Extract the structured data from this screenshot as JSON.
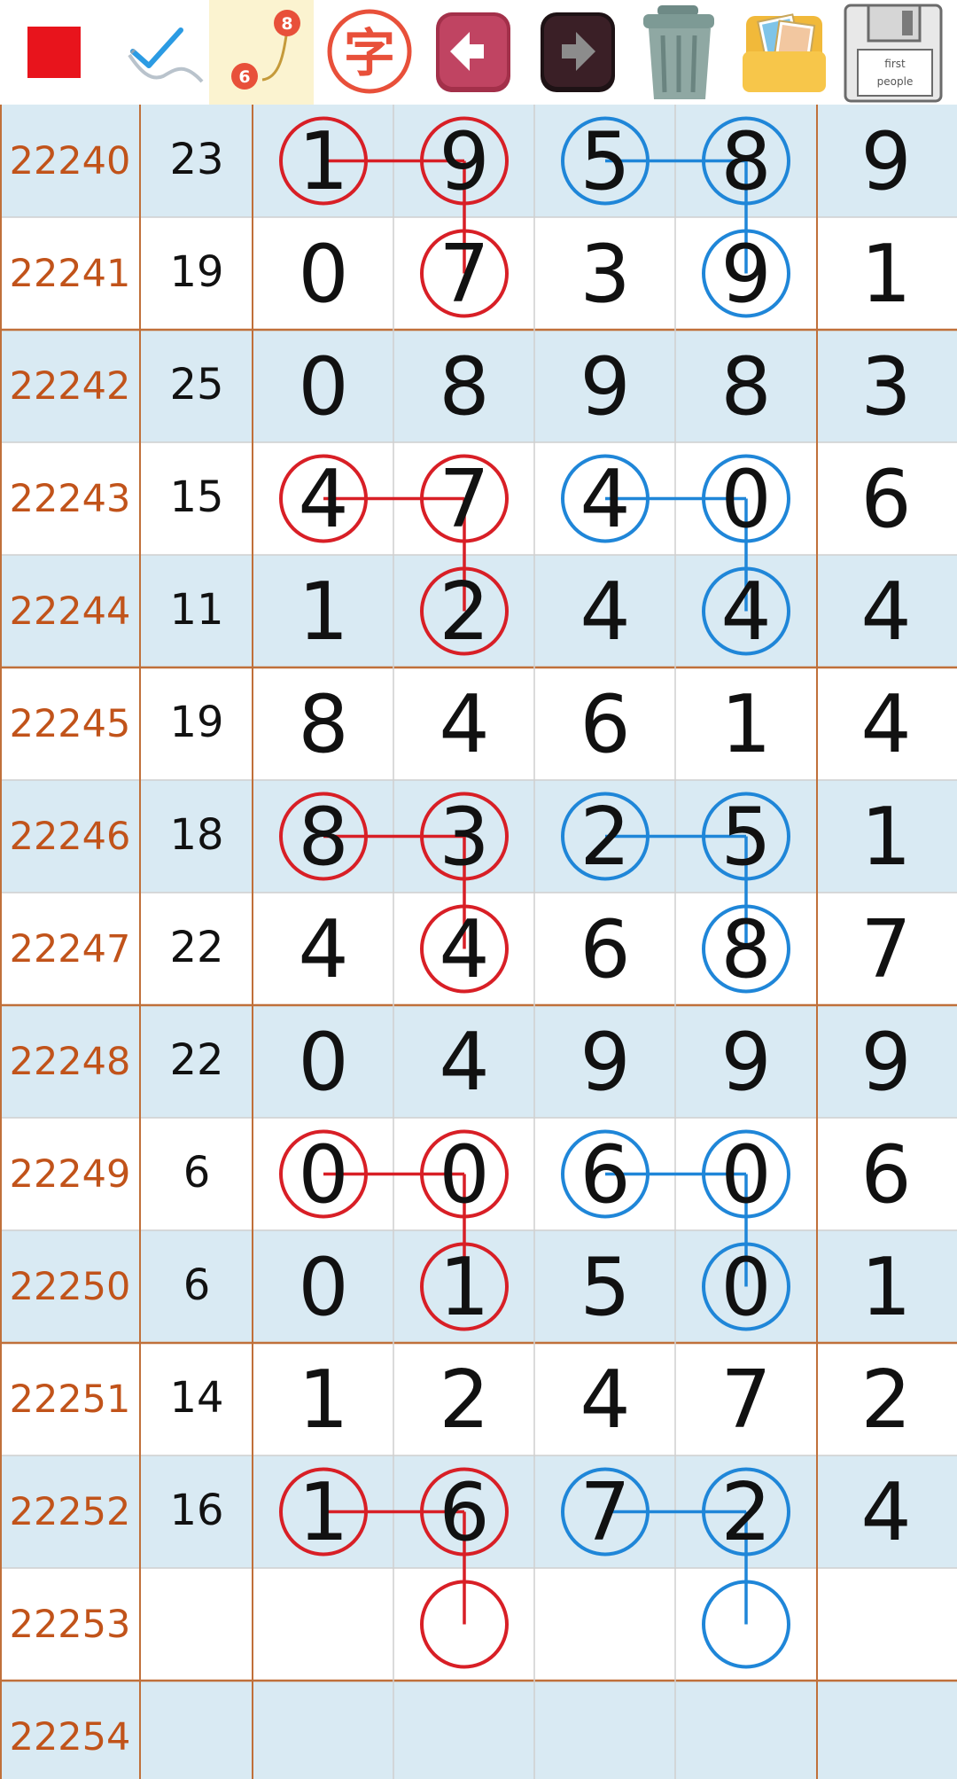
{
  "toolbar": {
    "buttons": [
      {
        "name": "red-square-color-button",
        "icon": "red-square-icon",
        "color": "#e8141c"
      },
      {
        "name": "checkmark-pen-button",
        "icon": "checkmark-pen-icon"
      },
      {
        "name": "connect-line-tool-button",
        "icon": "connect-line-icon",
        "label_top": "8",
        "label_bottom": "6",
        "active": true
      },
      {
        "name": "text-tool-button",
        "icon": "zi-character-icon",
        "label": "字"
      },
      {
        "name": "undo-button",
        "icon": "arrow-left-icon"
      },
      {
        "name": "redo-button",
        "icon": "arrow-right-icon"
      },
      {
        "name": "trash-button",
        "icon": "trash-can-icon"
      },
      {
        "name": "photo-folder-button",
        "icon": "photo-folder-icon"
      },
      {
        "name": "save-button",
        "icon": "floppy-disk-icon",
        "label_lines": [
          "first",
          "people"
        ]
      }
    ]
  },
  "colors": {
    "issue_text": "#c1531a",
    "row_shade": "#d9eaf3",
    "row_plain": "#ffffff",
    "red_mark": "#d81f26",
    "blue_mark": "#1f86d8",
    "group_line": "#c0703a",
    "grid_line": "#cfcfcf"
  },
  "rows": [
    {
      "issue": "22240",
      "sum": "23",
      "digits": [
        "1",
        "9",
        "5",
        "8",
        "9"
      ]
    },
    {
      "issue": "22241",
      "sum": "19",
      "digits": [
        "0",
        "7",
        "3",
        "9",
        "1"
      ]
    },
    {
      "issue": "22242",
      "sum": "25",
      "digits": [
        "0",
        "8",
        "9",
        "8",
        "3"
      ]
    },
    {
      "issue": "22243",
      "sum": "15",
      "digits": [
        "4",
        "7",
        "4",
        "0",
        "6"
      ]
    },
    {
      "issue": "22244",
      "sum": "11",
      "digits": [
        "1",
        "2",
        "4",
        "4",
        "4"
      ]
    },
    {
      "issue": "22245",
      "sum": "19",
      "digits": [
        "8",
        "4",
        "6",
        "1",
        "4"
      ]
    },
    {
      "issue": "22246",
      "sum": "18",
      "digits": [
        "8",
        "3",
        "2",
        "5",
        "1"
      ]
    },
    {
      "issue": "22247",
      "sum": "22",
      "digits": [
        "4",
        "4",
        "6",
        "8",
        "7"
      ]
    },
    {
      "issue": "22248",
      "sum": "22",
      "digits": [
        "0",
        "4",
        "9",
        "9",
        "9"
      ]
    },
    {
      "issue": "22249",
      "sum": "6",
      "digits": [
        "0",
        "0",
        "6",
        "0",
        "6"
      ]
    },
    {
      "issue": "22250",
      "sum": "6",
      "digits": [
        "0",
        "1",
        "5",
        "0",
        "1"
      ]
    },
    {
      "issue": "22251",
      "sum": "14",
      "digits": [
        "1",
        "2",
        "4",
        "7",
        "2"
      ]
    },
    {
      "issue": "22252",
      "sum": "16",
      "digits": [
        "1",
        "6",
        "7",
        "2",
        "4"
      ]
    },
    {
      "issue": "22253",
      "sum": "",
      "digits": [
        "",
        "",
        "",
        "",
        ""
      ]
    },
    {
      "issue": "22254",
      "sum": "",
      "digits": [
        "",
        "",
        "",
        "",
        ""
      ]
    }
  ],
  "marks": [
    {
      "rows": [
        0,
        1
      ],
      "color": "red"
    },
    {
      "rows": [
        3,
        4
      ],
      "color": "red"
    },
    {
      "rows": [
        6,
        7
      ],
      "color": "red"
    },
    {
      "rows": [
        9,
        10
      ],
      "color": "red"
    },
    {
      "rows": [
        12,
        13
      ],
      "color": "red"
    },
    {
      "rows": [
        0,
        1
      ],
      "color": "blue"
    },
    {
      "rows": [
        3,
        4
      ],
      "color": "blue"
    },
    {
      "rows": [
        6,
        7
      ],
      "color": "blue"
    },
    {
      "rows": [
        9,
        10
      ],
      "color": "blue"
    },
    {
      "rows": [
        12,
        13
      ],
      "color": "blue"
    }
  ]
}
